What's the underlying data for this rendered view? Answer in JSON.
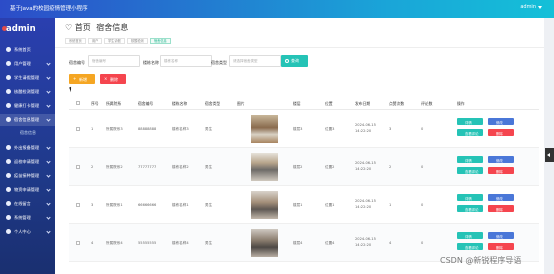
{
  "topbar": {
    "title": "基于Java的校园疫情管理小程序",
    "user": "admin"
  },
  "sidebar": {
    "brand": "admin",
    "items": [
      {
        "label": "系统首页",
        "icon": "home-icon"
      },
      {
        "label": "用户管理",
        "icon": "user-icon"
      },
      {
        "label": "学生请假管理",
        "icon": "doc-icon"
      },
      {
        "label": "核酸检测管理",
        "icon": "test-icon"
      },
      {
        "label": "健康打卡管理",
        "icon": "heart-icon"
      },
      {
        "label": "宿舍信息管理",
        "icon": "building-icon"
      },
      {
        "label": "外出报备管理",
        "icon": "exit-icon"
      },
      {
        "label": "返校申请管理",
        "icon": "return-icon"
      },
      {
        "label": "疫苗接种管理",
        "icon": "vaccine-icon"
      },
      {
        "label": "物资申请管理",
        "icon": "box-icon"
      },
      {
        "label": "在线留言",
        "icon": "chat-icon"
      },
      {
        "label": "系统管理",
        "icon": "gear-icon"
      },
      {
        "label": "个人中心",
        "icon": "person-icon"
      }
    ],
    "sub_item": "宿舍信息"
  },
  "page": {
    "home": "首页",
    "title": "宿舍信息",
    "crumbs": [
      "系统首页",
      "用户",
      "学生请假",
      "核酸检测",
      "宿舍信息"
    ]
  },
  "filters": {
    "f1_label": "宿舍编号",
    "f1_placeholder": "宿舍编号",
    "f2_label": "楼栋名称",
    "f2_placeholder": "楼栋名称",
    "f3_label": "宿舍类型",
    "f3_placeholder": "请选择宿舍类型",
    "search": "查询"
  },
  "actions": {
    "add": "新增",
    "delete": "删除"
  },
  "table": {
    "headers": [
      "序号",
      "所属院系",
      "宿舍编号",
      "楼栋名称",
      "宿舍类型",
      "图片",
      "楼层",
      "位置",
      "发布日期",
      "点赞次数",
      "评论数",
      "操作"
    ],
    "rows": [
      {
        "no": "1",
        "dept": "所属院系3",
        "num": "88888888",
        "bld": "楼栋名称3",
        "type": "男生",
        "floor": "楼层3",
        "pos": "位置3",
        "date": "2024-06-15 14:22:20",
        "likes": "3",
        "comments": "0"
      },
      {
        "no": "2",
        "dept": "所属院系2",
        "num": "77777777",
        "bld": "楼栋名称2",
        "type": "男生",
        "floor": "楼层2",
        "pos": "位置2",
        "date": "2024-06-15 14:22:20",
        "likes": "2",
        "comments": "0"
      },
      {
        "no": "3",
        "dept": "所属院系1",
        "num": "66666666",
        "bld": "楼栋名称1",
        "type": "男生",
        "floor": "楼层1",
        "pos": "位置1",
        "date": "2024-06-15 14:22:20",
        "likes": "1",
        "comments": "0"
      },
      {
        "no": "4",
        "dept": "所属院系4",
        "num": "55555555",
        "bld": "楼栋名称4",
        "type": "男生",
        "floor": "楼层4",
        "pos": "位置4",
        "date": "2024-06-15 14:22:20",
        "likes": "4",
        "comments": "0"
      }
    ],
    "op": {
      "detail": "详情",
      "edit": "修改",
      "comment": "查看评论",
      "del": "删除"
    }
  },
  "watermark": "CSDN @新锐程序导语",
  "colors": {
    "search": "#25c3b6",
    "add": "#f5a623",
    "delete": "#f5454e",
    "detail": "#25c3b6",
    "edit": "#4a77d8"
  }
}
